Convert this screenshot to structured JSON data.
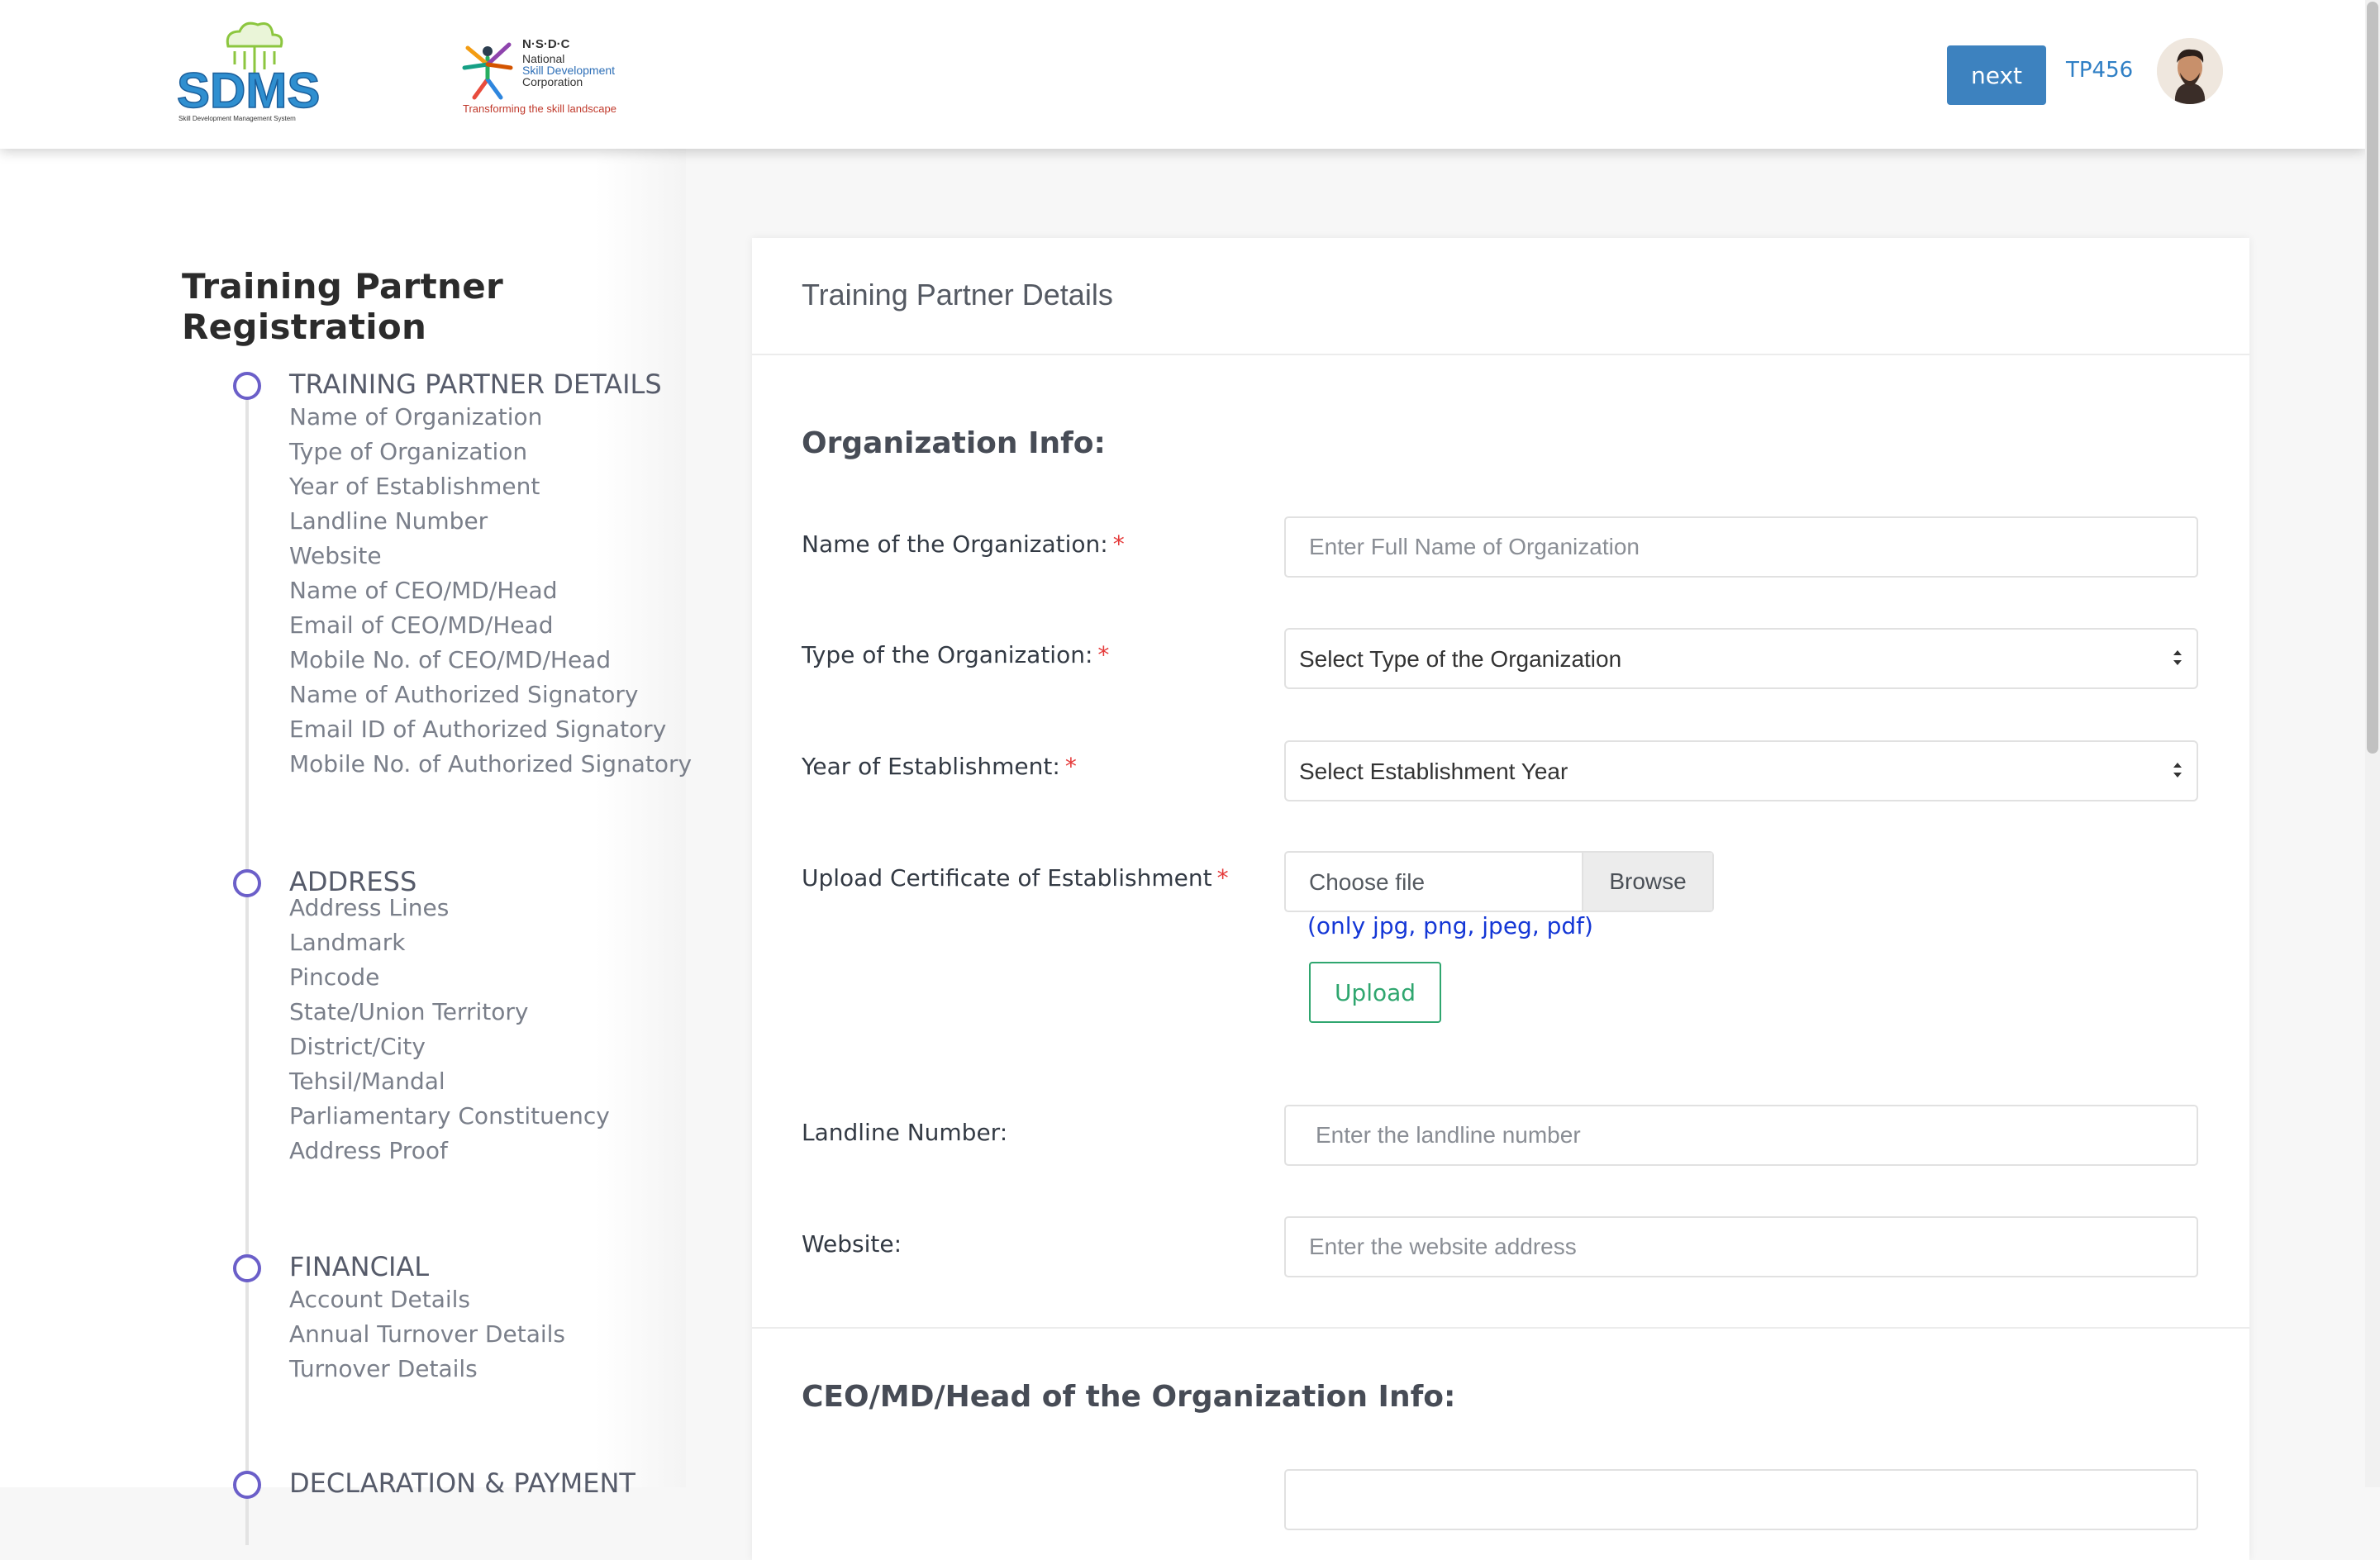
{
  "header": {
    "logo_sdms_text": "SDMS",
    "logo_sdms_subtitle": "Skill Development Management System",
    "logo_nsdc_abbr": "N·S·D·C",
    "logo_nsdc_name_line1": "National",
    "logo_nsdc_name_line2": "Skill Development",
    "logo_nsdc_name_line3": "Corporation",
    "logo_nsdc_tagline": "Transforming the skill landscape",
    "next_label": "next",
    "user_id": "TP456"
  },
  "sidebar": {
    "title": "Training Partner Registration",
    "steps": [
      {
        "title": "TRAINING PARTNER DETAILS",
        "items": [
          "Name of Organization",
          "Type of Organization",
          "Year of Establishment",
          "Landline Number",
          "Website",
          "Name of CEO/MD/Head",
          "Email of CEO/MD/Head",
          "Mobile No. of CEO/MD/Head",
          "Name of Authorized Signatory",
          "Email ID of Authorized Signatory",
          "Mobile No. of Authorized Signatory"
        ]
      },
      {
        "title": "ADDRESS",
        "items": [
          "Address Lines",
          "Landmark",
          "Pincode",
          "State/Union Territory",
          "District/City",
          "Tehsil/Mandal",
          "Parliamentary Constituency",
          "Address Proof"
        ]
      },
      {
        "title": "FINANCIAL",
        "items": [
          "Account Details",
          "Annual Turnover Details",
          "Turnover Details"
        ]
      },
      {
        "title": "DECLARATION & PAYMENT",
        "items": []
      }
    ]
  },
  "main": {
    "card_title": "Training Partner Details",
    "org_section_title": "Organization Info:",
    "fields": {
      "name": {
        "label": "Name of the Organization:",
        "placeholder": "Enter Full Name of Organization",
        "required_mark": "*"
      },
      "type": {
        "label": "Type of the Organization:",
        "selected": "Select Type of the Organization",
        "required_mark": "*"
      },
      "year": {
        "label": "Year of Establishment:",
        "selected": "Select Establishment Year",
        "required_mark": "*"
      },
      "certificate": {
        "label": "Upload Certificate of Establishment",
        "required_mark": "*",
        "file_placeholder": "Choose file",
        "browse_label": "Browse",
        "hint": "(only jpg, png, jpeg, pdf)",
        "upload_label": "Upload"
      },
      "landline": {
        "label": "Landline Number:",
        "placeholder": "Enter the landline number"
      },
      "website": {
        "label": "Website:",
        "placeholder": "Enter the website address"
      }
    },
    "ceo_section_title": "CEO/MD/Head of the Organization Info:"
  },
  "colors": {
    "primary_button": "#3d82bf",
    "accent_purple": "#6b5fc9",
    "required_red": "#e53a3a",
    "upload_green": "#2fa66f",
    "hint_blue": "#1437d6"
  }
}
